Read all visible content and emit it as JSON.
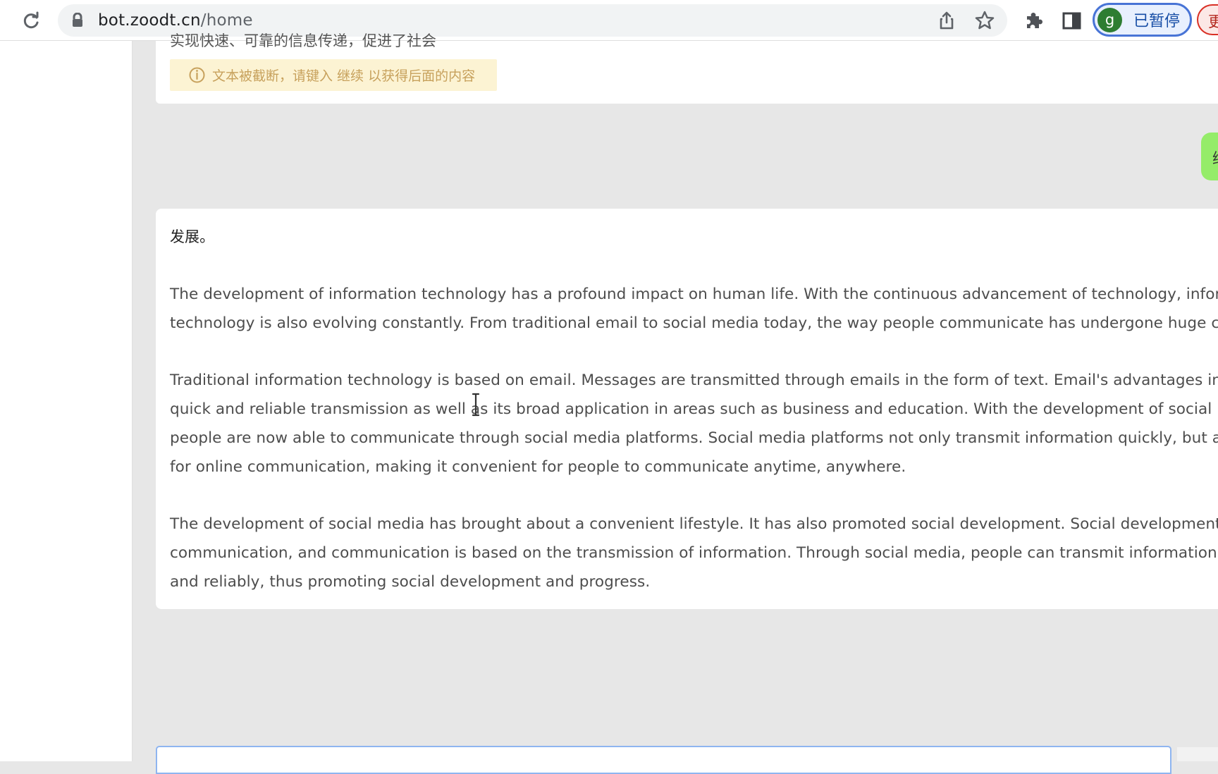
{
  "browser": {
    "url_host": "bot.zoodt.cn",
    "url_path": "/home",
    "profile_initial": "g",
    "profile_status": "已暂停",
    "update_fragment": "更"
  },
  "chat": {
    "clipped_previous_line": "实现快速、可靠的信息传递，促进了社会",
    "truncation_notice": "文本被截断，请键入 继续 以获得后面的内容",
    "user_message_fragment": "继",
    "reply": {
      "lead": "发展。",
      "paragraphs": [
        "The development of information technology has a profound impact on human life. With the continuous advancement of technology, information technology is also evolving constantly. From traditional email to social media today, the way people communicate has undergone huge changes.",
        "Traditional information technology is based on email. Messages are transmitted through emails in the form of text. Email's advantages include quick and reliable transmission as well as its broad application in areas such as business and education. With the development of social media, people are now able to communicate through social media platforms. Social media platforms not only transmit information quickly, but also allow for online communication, making it convenient for people to communicate anytime, anywhere.",
        "The development of social media has brought about a convenient lifestyle. It has also promoted social development. Social development requires communication, and communication is based on the transmission of information. Through social media, people can transmit information quickly and reliably, thus promoting social development and progress."
      ]
    }
  },
  "icons": {
    "reload": "reload-icon",
    "lock": "lock-icon",
    "share": "share-icon",
    "bookmark": "star-icon",
    "extensions": "puzzle-icon",
    "side_panel": "side-panel-icon",
    "info": "info-icon",
    "text_cursor": "text-cursor-icon"
  },
  "colors": {
    "page_background": "#e7e7e7",
    "message_background": "#ffffff",
    "warning_background": "#fcf3d3",
    "warning_text": "#c7a15c",
    "user_bubble": "#95ec69",
    "profile_border": "#4874d6",
    "avatar": "#2e7d32"
  }
}
